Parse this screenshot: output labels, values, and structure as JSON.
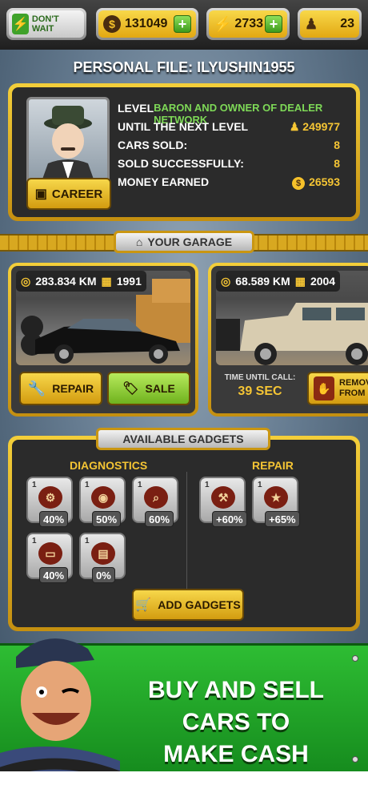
{
  "topbar": {
    "dont_wait": "DON'T WAIT",
    "money": "131049",
    "energy": "2733",
    "people": "23"
  },
  "profile": {
    "title": "PERSONAL FILE: ILYUSHIN1955",
    "career_label": "CAREER",
    "rows": [
      {
        "k": "LEVEL",
        "v": "BARON AND OWNER OF DEALER NETWORK"
      },
      {
        "k": "UNTIL THE NEXT LEVEL",
        "v": "249977"
      },
      {
        "k": "CARS SOLD:",
        "v": "8"
      },
      {
        "k": "SOLD SUCCESSFULLY:",
        "v": "8"
      },
      {
        "k": "MONEY EARNED",
        "v": "26593"
      }
    ]
  },
  "garage": {
    "banner": "YOUR GARAGE",
    "cars": [
      {
        "km": "283.834 KM",
        "year": "1991",
        "repair": "REPAIR",
        "sale": "SALE"
      },
      {
        "km": "68.589 KM",
        "year": "2004",
        "time_label": "TIME UNTIL CALL:",
        "time_value": "39 SEC",
        "remove": "REMOVE FROM SA"
      }
    ]
  },
  "gadgets": {
    "banner": "AVAILABLE GADGETS",
    "diag_title": "DIAGNOSTICS",
    "repair_title": "REPAIR",
    "level": "1",
    "diag": [
      "40%",
      "50%",
      "60%",
      "40%",
      "0%"
    ],
    "repair": [
      "+60%",
      "+65%"
    ],
    "add_label": "ADD GADGETS"
  },
  "promo": {
    "line1": "BUY AND SELL CARS TO",
    "line2": "MAKE CASH"
  }
}
